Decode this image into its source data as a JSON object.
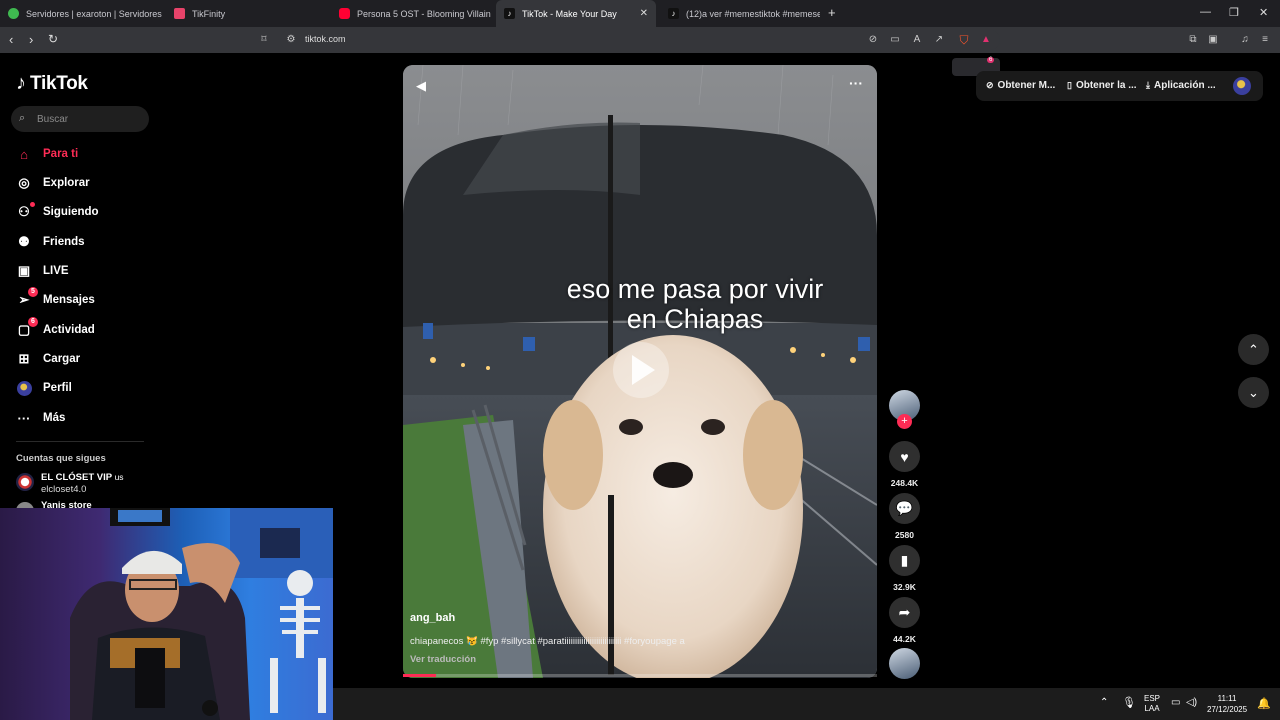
{
  "tabs": [
    {
      "title": "Servidores | exaroton | Servidores de",
      "favicon_color": "#3fb950"
    },
    {
      "title": "TikFinity",
      "favicon_color": "#e7436a"
    },
    {
      "title": "Persona 5 OST - Blooming Villain [Ext",
      "favicon_color": "#ff0033"
    },
    {
      "title": "TikTok - Make Your Day",
      "favicon_color": "#111111",
      "active": true
    },
    {
      "title": "(12)a ver #memestiktok #memesene",
      "favicon_color": "#111111"
    }
  ],
  "window_controls": {
    "minimize": "—",
    "maximize": "❐",
    "close": "✕",
    "new_tab": "+"
  },
  "address": {
    "url": "tiktok.com"
  },
  "brave_badge": "6",
  "sidebar": {
    "logo": "TikTok",
    "search_placeholder": "Buscar",
    "nav": [
      {
        "label": "Para ti",
        "icon": "home-icon",
        "active": true
      },
      {
        "label": "Explorar",
        "icon": "compass-icon"
      },
      {
        "label": "Siguiendo",
        "icon": "following-icon",
        "dot": true
      },
      {
        "label": "Friends",
        "icon": "friends-icon"
      },
      {
        "label": "LIVE",
        "icon": "live-tv-icon"
      },
      {
        "label": "Mensajes",
        "icon": "messages-icon",
        "badge": "5"
      },
      {
        "label": "Actividad",
        "icon": "activity-icon",
        "badge": "6"
      },
      {
        "label": "Cargar",
        "icon": "upload-icon"
      },
      {
        "label": "Perfil",
        "icon": "profile-avatar"
      },
      {
        "label": "Más",
        "icon": "more-dots-icon"
      }
    ],
    "following_title": "Cuentas que sigues",
    "following": [
      {
        "name": "EL CLÓSET VIP",
        "suffix": "us",
        "handle": "elcloset4.0"
      },
      {
        "name": "Yanis store",
        "handle": ""
      }
    ]
  },
  "video": {
    "caption_line1": "eso me pasa por vivir",
    "caption_line2": "en Chiapas",
    "username": "ang_bah",
    "description": "chiapanecos 😿 #fyp #sillycat #paratiiiiiiiiiiiiiiiiiiiiiiiiiii #foryoupage a",
    "translate": "Ver traducción",
    "progress": 0.07
  },
  "actions": {
    "likes": "248.4K",
    "comments": "2580",
    "saves": "32.9K",
    "shares": "44.2K"
  },
  "top_right": {
    "btn1": "Obtener M...",
    "btn2": "Obtener la ...",
    "btn3": "Aplicación ..."
  },
  "taskbar": {
    "lang_top": "ESP",
    "lang_bottom": "LAA",
    "time": "11:11",
    "date": "27/12/2025"
  }
}
